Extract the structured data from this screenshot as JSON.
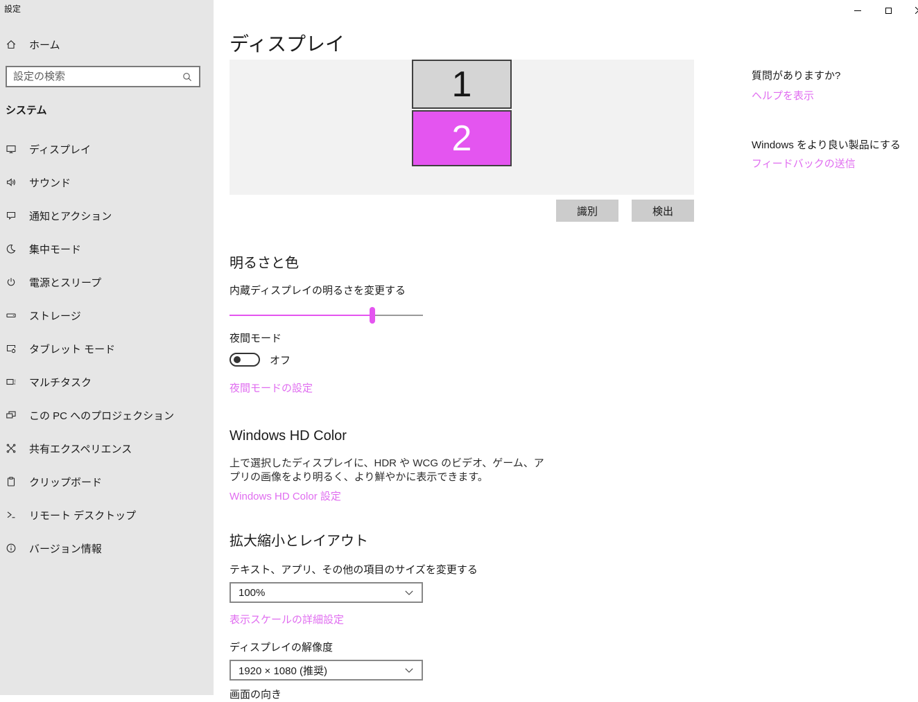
{
  "window": {
    "title": "設定"
  },
  "sidebar": {
    "home_label": "ホーム",
    "search_placeholder": "設定の検索",
    "section_heading": "システム",
    "items": [
      {
        "icon": "display-icon",
        "label": "ディスプレイ"
      },
      {
        "icon": "sound-icon",
        "label": "サウンド"
      },
      {
        "icon": "notifications-icon",
        "label": "通知とアクション"
      },
      {
        "icon": "focus-assist-icon",
        "label": "集中モード"
      },
      {
        "icon": "power-sleep-icon",
        "label": "電源とスリープ"
      },
      {
        "icon": "storage-icon",
        "label": "ストレージ"
      },
      {
        "icon": "tablet-mode-icon",
        "label": "タブレット モード"
      },
      {
        "icon": "multitasking-icon",
        "label": "マルチタスク"
      },
      {
        "icon": "projecting-icon",
        "label": "この PC へのプロジェクション"
      },
      {
        "icon": "shared-experiences-icon",
        "label": "共有エクスペリエンス"
      },
      {
        "icon": "clipboard-icon",
        "label": "クリップボード"
      },
      {
        "icon": "remote-desktop-icon",
        "label": "リモート デスクトップ"
      },
      {
        "icon": "about-icon",
        "label": "バージョン情報"
      }
    ]
  },
  "main": {
    "title": "ディスプレイ",
    "monitors": [
      {
        "number": "1"
      },
      {
        "number": "2"
      }
    ],
    "identify_button": "識別",
    "detect_button": "検出",
    "brightness": {
      "heading": "明るさと色",
      "slider_label": "内蔵ディスプレイの明るさを変更する",
      "slider_value_pct": 74,
      "night_mode_label": "夜間モード",
      "night_mode_state": "オフ",
      "night_mode_link": "夜間モードの設定"
    },
    "hd_color": {
      "heading": "Windows HD Color",
      "description": "上で選択したディスプレイに、HDR や WCG のビデオ、ゲーム、アプリの画像をより明るく、より鮮やかに表示できます。",
      "link": "Windows HD Color 設定"
    },
    "scale_layout": {
      "heading": "拡大縮小とレイアウト",
      "size_label": "テキスト、アプリ、その他の項目のサイズを変更する",
      "scale_value": "100%",
      "scale_link": "表示スケールの詳細設定",
      "resolution_label": "ディスプレイの解像度",
      "resolution_value": "1920 × 1080 (推奨)",
      "orientation_label": "画面の向き"
    }
  },
  "right_rail": {
    "question_heading": "質問がありますか?",
    "help_link": "ヘルプを表示",
    "feedback_heading": "Windows をより良い製品にする",
    "feedback_link": "フィードバックの送信"
  },
  "colors": {
    "accent_link": "#e06df0",
    "monitor_accent": "#e455f0",
    "sidebar_bg": "#e6e6e6",
    "panel_bg": "#f2f2f2",
    "button_bg": "#cccccc"
  }
}
